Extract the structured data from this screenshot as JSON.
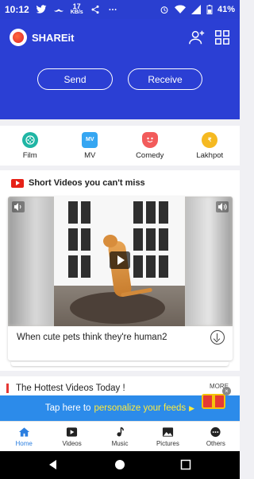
{
  "status_bar": {
    "time": "10:12",
    "net_speed_value": "17",
    "net_speed_unit": "KB/s",
    "battery": "41%"
  },
  "app": {
    "name": "SHAREit",
    "send_label": "Send",
    "receive_label": "Receive"
  },
  "categories": [
    {
      "label": "Film",
      "icon": "film-icon",
      "color": "#1fb5a4"
    },
    {
      "label": "MV",
      "icon": "mv-icon",
      "color": "#35a6f2"
    },
    {
      "label": "Comedy",
      "icon": "comedy-mask-icon",
      "color": "#f25b5b"
    },
    {
      "label": "Lakhpot",
      "icon": "rupee-coin-icon",
      "color": "#f5b921"
    }
  ],
  "short_videos": {
    "title": "Short Videos you can't miss",
    "video_caption": "When cute pets think they're human2"
  },
  "hottest": {
    "title": "The Hottest Videos Today !",
    "more_label": "MORE"
  },
  "banner": {
    "prefix": "Tap here to",
    "highlight": "personalize your feeds",
    "arrow": "▶"
  },
  "bottom_nav": [
    {
      "label": "Home",
      "icon": "home-icon",
      "active": true
    },
    {
      "label": "Videos",
      "icon": "play-icon",
      "active": false
    },
    {
      "label": "Music",
      "icon": "music-note-icon",
      "active": false
    },
    {
      "label": "Pictures",
      "icon": "picture-icon",
      "active": false
    },
    {
      "label": "Others",
      "icon": "more-dots-icon",
      "active": false
    }
  ],
  "colors": {
    "header_blue": "#2b3fd4",
    "accent_blue": "#2b7fe0",
    "banner_blue": "#2c8bea",
    "highlight_yellow": "#ffeb3b"
  }
}
